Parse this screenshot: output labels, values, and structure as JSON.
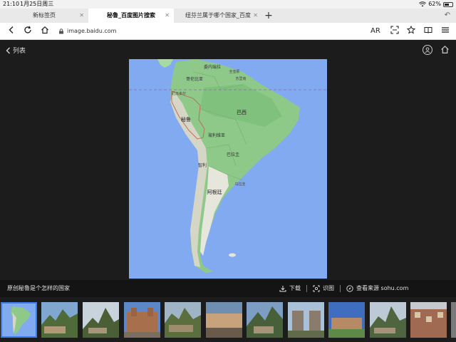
{
  "status": {
    "time": "21:10",
    "date": "1月25日周三",
    "battery": "62%",
    "battery_level": 0.62
  },
  "tabs": [
    {
      "label": "新标签页"
    },
    {
      "label": "秘鲁_百度图片搜索"
    },
    {
      "label": "纽芬兰属于哪个国家_百度"
    }
  ],
  "toolbar": {
    "url": "image.baidu.com",
    "ar_label": "AR"
  },
  "viewer": {
    "back_label": "列表"
  },
  "map": {
    "labels": [
      "委内瑞拉",
      "圭亚那",
      "哥伦比亚",
      "苏里南",
      "厄瓜多尔",
      "秘鲁",
      "巴西",
      "玻利维亚",
      "巴拉圭",
      "智利",
      "乌拉圭",
      "阿根廷"
    ]
  },
  "caption": {
    "text": "原创秘鲁是个怎样的国家",
    "download": "下载",
    "identify": "识图",
    "source": "查看来源 sohu.com"
  },
  "icons": [
    "back-icon",
    "reload-icon",
    "home-icon",
    "lock-icon",
    "scan-icon",
    "star-icon",
    "book-icon",
    "menu-icon",
    "download-icon",
    "identify-icon",
    "compass-icon"
  ]
}
